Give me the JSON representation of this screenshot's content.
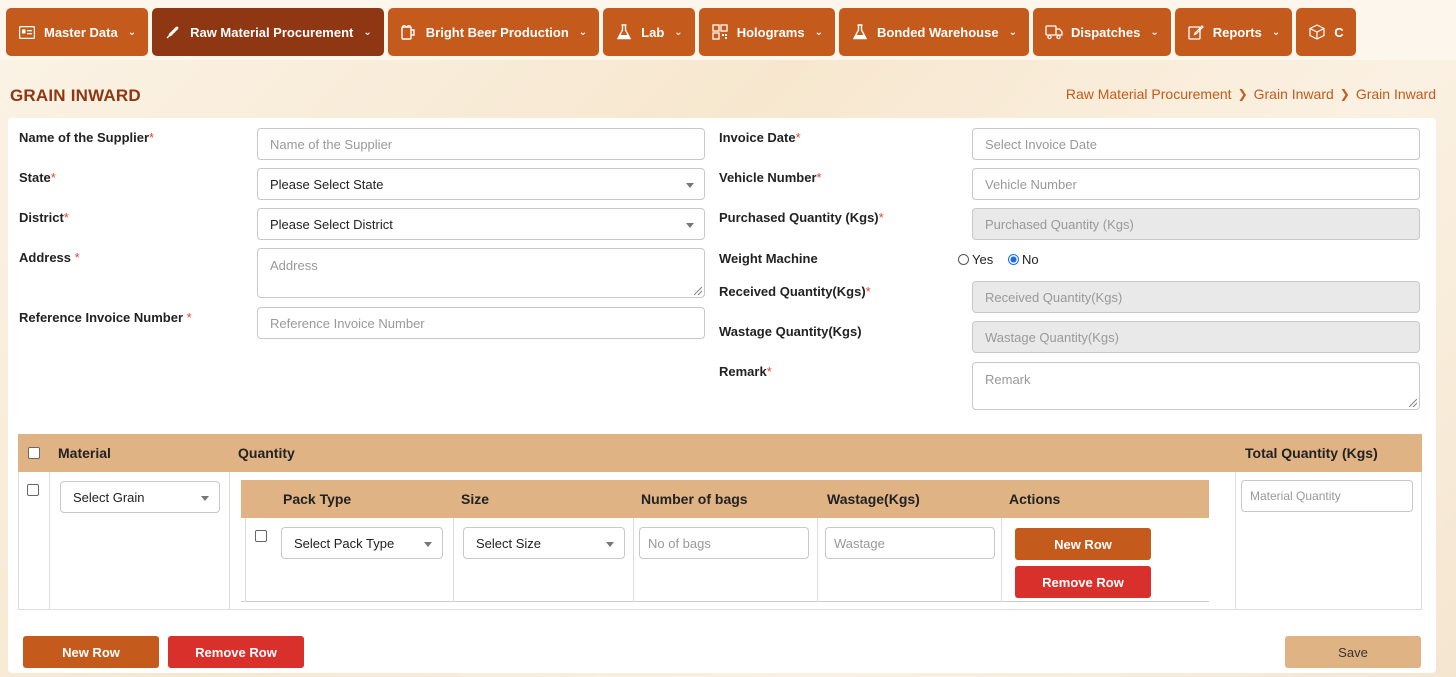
{
  "nav": [
    {
      "label": "Master Data",
      "icon": "id-card-icon",
      "active": false
    },
    {
      "label": "Raw Material Procurement",
      "icon": "wheat-icon",
      "active": true
    },
    {
      "label": "Bright Beer Production",
      "icon": "beer-icon",
      "active": false
    },
    {
      "label": "Lab",
      "icon": "flask-icon",
      "active": false
    },
    {
      "label": "Holograms",
      "icon": "qr-icon",
      "active": false
    },
    {
      "label": "Bonded Warehouse",
      "icon": "flask-icon",
      "active": false
    },
    {
      "label": "Dispatches",
      "icon": "truck-icon",
      "active": false
    },
    {
      "label": "Reports",
      "icon": "edit-icon",
      "active": false
    },
    {
      "label": "C",
      "icon": "box-icon",
      "active": false
    }
  ],
  "page": {
    "title": "GRAIN INWARD",
    "breadcrumb": [
      "Raw Material Procurement",
      "Grain Inward",
      "Grain Inward"
    ]
  },
  "form": {
    "supplier": {
      "label": "Name of the Supplier",
      "placeholder": "Name of the Supplier"
    },
    "state": {
      "label": "State",
      "value": "Please Select State"
    },
    "district": {
      "label": "District",
      "value": "Please Select District"
    },
    "address": {
      "label": "Address ",
      "placeholder": "Address"
    },
    "ref_invoice": {
      "label": "Reference Invoice Number ",
      "placeholder": "Reference Invoice Number"
    },
    "invoice_date": {
      "label": "Invoice Date",
      "placeholder": "Select Invoice Date"
    },
    "vehicle": {
      "label": "Vehicle Number",
      "placeholder": "Vehicle Number"
    },
    "purchased_qty": {
      "label": "Purchased Quantity (Kgs)",
      "placeholder": "Purchased Quantity (Kgs)"
    },
    "weight_machine": {
      "label": "Weight Machine",
      "options": [
        "Yes",
        "No"
      ],
      "selected": "No"
    },
    "received_qty": {
      "label": "Received Quantity(Kgs)",
      "placeholder": "Received Quantity(Kgs)"
    },
    "wastage_qty": {
      "label": "Wastage Quantity(Kgs)",
      "placeholder": "Wastage Quantity(Kgs)"
    },
    "remark": {
      "label": "Remark",
      "placeholder": "Remark"
    },
    "required_mark": "*"
  },
  "table": {
    "headers": {
      "material": "Material",
      "quantity": "Quantity",
      "total": "Total Quantity (Kgs)"
    },
    "material_select": "Select Grain",
    "total_placeholder": "Material Quantity",
    "inner_headers": [
      "Pack Type",
      "Size",
      "Number of bags",
      "Wastage(Kgs)",
      "Actions"
    ],
    "pack_type_select": "Select Pack Type",
    "size_select": "Select Size",
    "bags_placeholder": "No of bags",
    "wastage_placeholder": "Wastage",
    "inner_new_row": "New Row",
    "inner_remove_row": "Remove Row"
  },
  "footer": {
    "new_row": "New Row",
    "remove_row": "Remove Row",
    "save": "Save"
  },
  "colors": {
    "primary": "#c45a1b",
    "active": "#8e3712",
    "danger": "#d9302c",
    "header": "#e0b384"
  }
}
